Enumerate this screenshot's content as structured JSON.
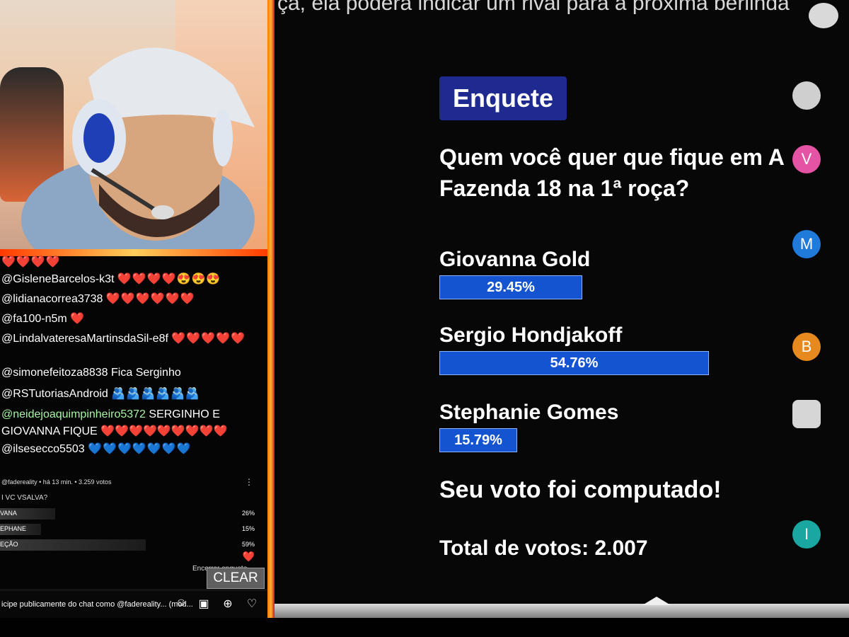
{
  "chat": {
    "messages": [
      {
        "user": "@GisleneBarcelos-k3t",
        "text": "❤️❤️❤️❤️😍😍😍"
      },
      {
        "user": "@lidianacorrea3738",
        "text": "❤️❤️❤️❤️❤️❤️"
      },
      {
        "user": "@fa100-n5m",
        "text": "❤️"
      },
      {
        "user": "@LindalvateresaMartinsdaSil-e8f",
        "text": "❤️❤️❤️❤️❤️"
      },
      {
        "user": "@simonefeitoza8838",
        "text": "Fica Serginho"
      },
      {
        "user": "@RSTutoriasAndroid",
        "text": "🫂🫂🫂🫂🫂🫂"
      },
      {
        "user": "@neidejoaquimpinheiro5372",
        "text": "SERGINHO E GIOVANNA FIQUE ❤️❤️❤️❤️❤️❤️❤️❤️❤️"
      },
      {
        "user": "@ilsesecco5503",
        "text": "💙💙💙💙💙💙💙"
      }
    ],
    "poll_meta": "@fadereality • há 13 min. • 3.259 votos",
    "poll_question": "I VC VSALVA?",
    "poll_options": [
      {
        "label": "VANA",
        "pct": "26%"
      },
      {
        "label": "EPHANE",
        "pct": "15%"
      },
      {
        "label": "EÇÃO",
        "pct": "59%"
      }
    ],
    "poll_footer": "Encerrar enquete",
    "clear_label": "CLEAR",
    "input_text": "icipe publicamente do chat como @fadereality... (mod..."
  },
  "overlay": {
    "top_text": "ça, ela poderá indicar um rival para a próxima berlinda",
    "title": "Enquete",
    "question": "Quem você quer que fique em A Fazenda 18 na 1ª roça?",
    "options": [
      {
        "name": "Giovanna Gold",
        "pct": "29.45%",
        "value": 29.45
      },
      {
        "name": "Sergio Hondjakoff",
        "pct": "54.76%",
        "value": 54.76
      },
      {
        "name": "Stephanie Gomes",
        "pct": "15.79%",
        "value": 15.79
      }
    ],
    "computed": "Seu voto foi computado!",
    "total": "Total de votos: 2.007"
  },
  "side_avatars": [
    {
      "initial": "V",
      "color": "#e553a5"
    },
    {
      "initial": "M",
      "color": "#1f7ad9"
    },
    {
      "initial": "B",
      "color": "#e6891e"
    },
    {
      "initial": "I",
      "color": "#1aa6a1"
    }
  ]
}
